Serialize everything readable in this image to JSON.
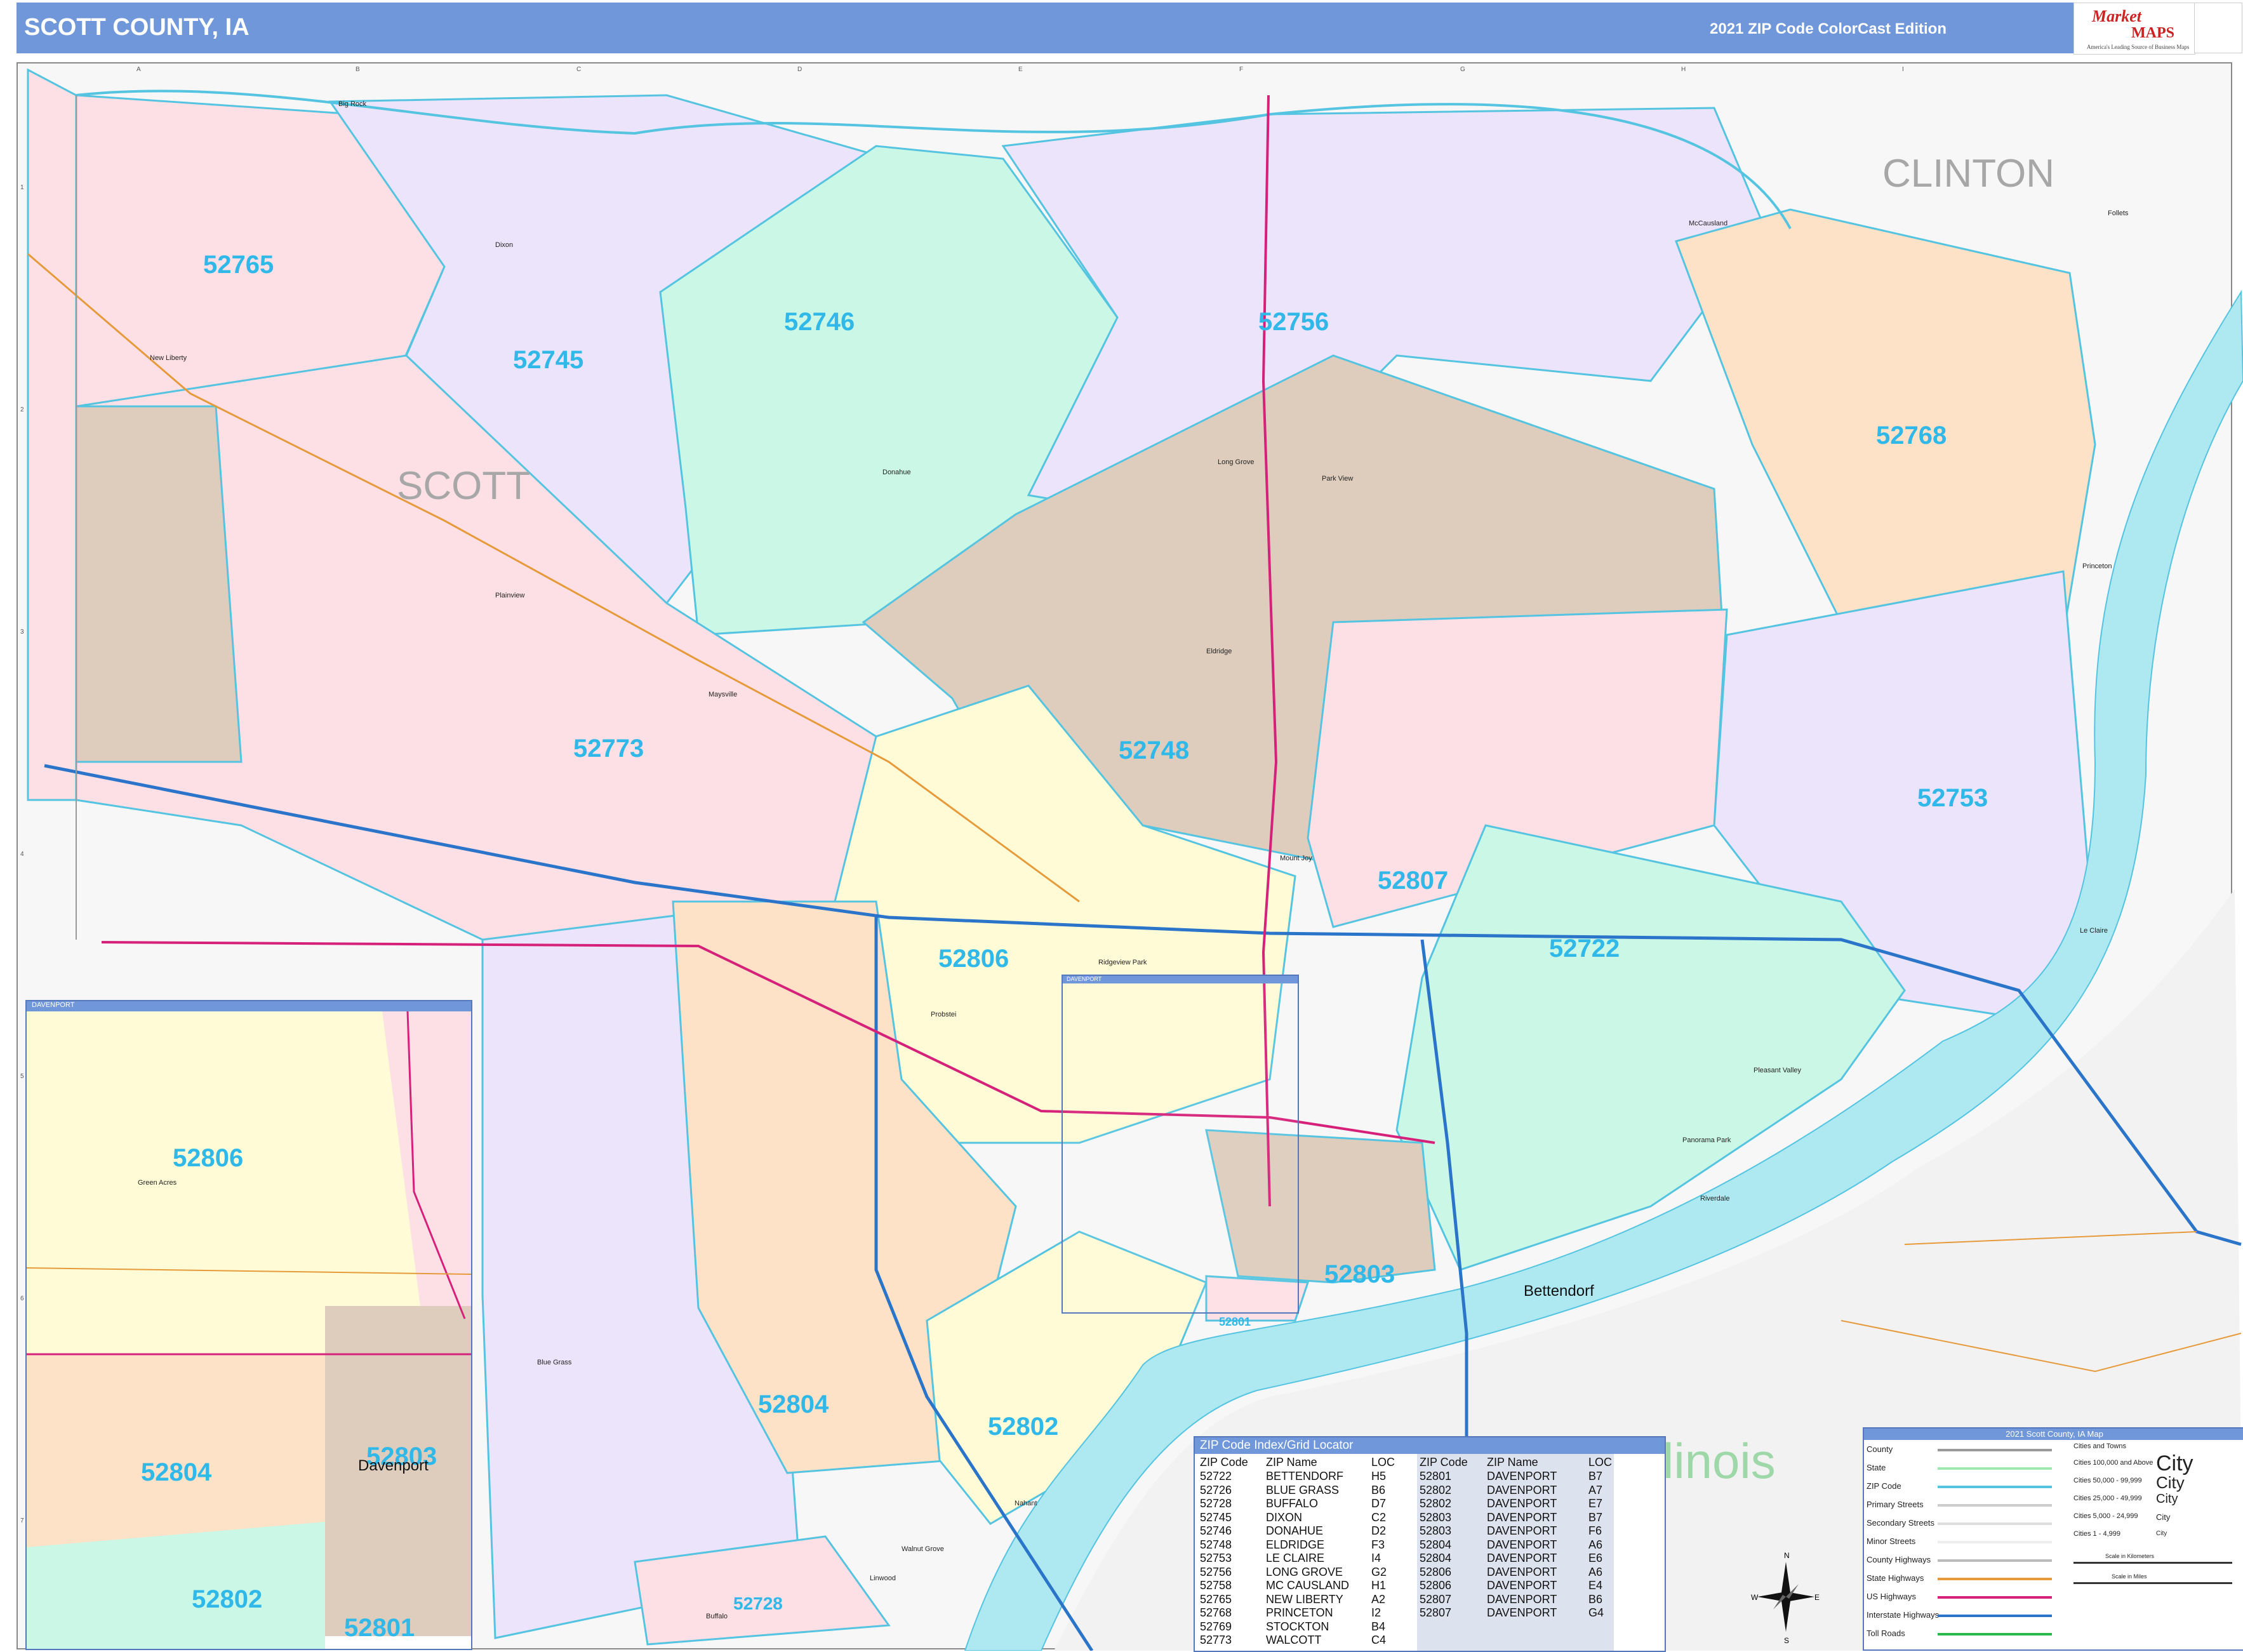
{
  "header": {
    "title": "SCOTT COUNTY, IA",
    "edition": "2021 ZIP Code ColorCast Edition",
    "logo_line1": "Market",
    "logo_line2": "MAPS",
    "logo_tagline": "America's Leading Source of Business Maps"
  },
  "colors": {
    "pink": "#fde0e6",
    "lavender": "#ece4fb",
    "mint": "#cbf7e6",
    "tan": "#decdbd",
    "yellow": "#fffbd6",
    "peach": "#fde2c8",
    "zip_label": "#2fb8e8",
    "zip_border": "#55c4e0",
    "river": "#aee9f2",
    "interstate": "#2a74c9",
    "us_highway": "#d6217a",
    "state_highway": "#e69a3a",
    "title_bar": "#6f97d9"
  },
  "map": {
    "county_labels": [
      "SCOTT",
      "CLINTON"
    ],
    "state_labels": [
      "Illinois"
    ],
    "zip_labels": [
      "52765",
      "52745",
      "52746",
      "52756",
      "52768",
      "52773",
      "52748",
      "52753",
      "52807",
      "52722",
      "52806",
      "52804",
      "52802",
      "52803",
      "52728",
      "52801",
      "52806",
      "52804",
      "52802",
      "52801",
      "52803"
    ],
    "city_labels": [
      "Bettendorf",
      "Davenport"
    ],
    "town_labels": [
      "Big Rock",
      "Dixon",
      "New Liberty",
      "Donahue",
      "Long Grove",
      "Park View",
      "McCausland",
      "Plainview",
      "Maysville",
      "Eldridge",
      "Mount Joy",
      "Princeton",
      "Le Claire",
      "Riverdale",
      "Pleasant Valley",
      "Panorama Park",
      "Blue Grass",
      "Walnut Grove",
      "Linwood",
      "Buffalo",
      "Nahant",
      "Green Acres",
      "Probstei",
      "Ridgeview Park",
      "Follets"
    ],
    "inset_title": "DAVENPORT",
    "inset2_title": "DAVENPORT"
  },
  "zip_index": {
    "title": "ZIP Code Index/Grid Locator",
    "headers": [
      "ZIP Code",
      "ZIP Name",
      "LOC",
      "ZIP Code",
      "ZIP Name",
      "LOC"
    ],
    "left": [
      [
        "52722",
        "BETTENDORF",
        "H5"
      ],
      [
        "52726",
        "BLUE GRASS",
        "B6"
      ],
      [
        "52728",
        "BUFFALO",
        "D7"
      ],
      [
        "52745",
        "DIXON",
        "C2"
      ],
      [
        "52746",
        "DONAHUE",
        "D2"
      ],
      [
        "52748",
        "ELDRIDGE",
        "F3"
      ],
      [
        "52753",
        "LE CLAIRE",
        "I4"
      ],
      [
        "52756",
        "LONG GROVE",
        "G2"
      ],
      [
        "52758",
        "MC CAUSLAND",
        "H1"
      ],
      [
        "52765",
        "NEW LIBERTY",
        "A2"
      ],
      [
        "52768",
        "PRINCETON",
        "I2"
      ],
      [
        "52769",
        "STOCKTON",
        "B4"
      ],
      [
        "52773",
        "WALCOTT",
        "C4"
      ]
    ],
    "right": [
      [
        "52801",
        "DAVENPORT",
        "B7"
      ],
      [
        "52802",
        "DAVENPORT",
        "A7"
      ],
      [
        "52802",
        "DAVENPORT",
        "E7"
      ],
      [
        "52803",
        "DAVENPORT",
        "B7"
      ],
      [
        "52803",
        "DAVENPORT",
        "F6"
      ],
      [
        "52804",
        "DAVENPORT",
        "A6"
      ],
      [
        "52804",
        "DAVENPORT",
        "E6"
      ],
      [
        "52806",
        "DAVENPORT",
        "A6"
      ],
      [
        "52806",
        "DAVENPORT",
        "E4"
      ],
      [
        "52807",
        "DAVENPORT",
        "B6"
      ],
      [
        "52807",
        "DAVENPORT",
        "G4"
      ]
    ]
  },
  "legend": {
    "title": "2021 Scott County, IA Map",
    "items": [
      "County",
      "State",
      "ZIP Code",
      "Primary Streets",
      "Secondary Streets",
      "Minor Streets",
      "County Highways",
      "State Highways",
      "US Highways",
      "Interstate Highways",
      "Toll Roads"
    ],
    "cities_header": "Cities and Towns",
    "city_sizes": [
      "Cities 100,000 and Above",
      "Cities 50,000 - 99,999",
      "Cities 25,000 - 49,999",
      "Cities 5,000 - 24,999",
      "Cities 1 - 4,999"
    ],
    "city_word": "City",
    "scale_km": "Scale in Kilometers",
    "scale_mi": "Scale in Miles"
  },
  "grid": {
    "letters": [
      "A",
      "B",
      "C",
      "D",
      "E",
      "F",
      "G",
      "H",
      "I"
    ],
    "numbers": [
      "1",
      "2",
      "3",
      "4",
      "5",
      "6",
      "7"
    ]
  },
  "compass": {
    "n": "N",
    "s": "S",
    "e": "E",
    "w": "W"
  }
}
